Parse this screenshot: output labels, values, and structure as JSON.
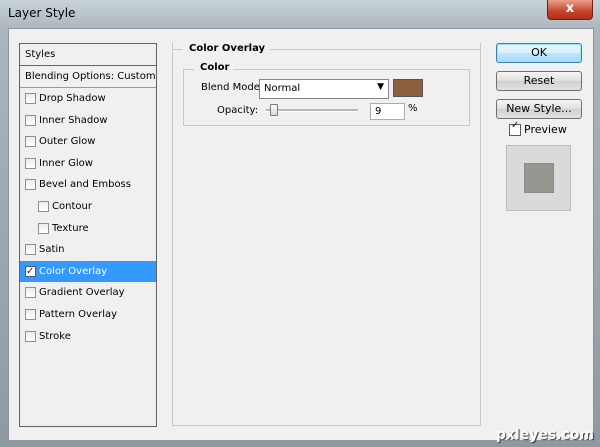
{
  "window": {
    "title": "Layer Style",
    "close_glyph": "x"
  },
  "styles": {
    "header": "Styles",
    "blending": "Blending Options: Custom",
    "items": [
      {
        "label": "Drop Shadow",
        "checked": false,
        "sub": false,
        "selected": false
      },
      {
        "label": "Inner Shadow",
        "checked": false,
        "sub": false,
        "selected": false
      },
      {
        "label": "Outer Glow",
        "checked": false,
        "sub": false,
        "selected": false
      },
      {
        "label": "Inner Glow",
        "checked": false,
        "sub": false,
        "selected": false
      },
      {
        "label": "Bevel and Emboss",
        "checked": false,
        "sub": false,
        "selected": false
      },
      {
        "label": "Contour",
        "checked": false,
        "sub": true,
        "selected": false
      },
      {
        "label": "Texture",
        "checked": false,
        "sub": true,
        "selected": false
      },
      {
        "label": "Satin",
        "checked": false,
        "sub": false,
        "selected": false
      },
      {
        "label": "Color Overlay",
        "checked": true,
        "sub": false,
        "selected": true
      },
      {
        "label": "Gradient Overlay",
        "checked": false,
        "sub": false,
        "selected": false
      },
      {
        "label": "Pattern Overlay",
        "checked": false,
        "sub": false,
        "selected": false
      },
      {
        "label": "Stroke",
        "checked": false,
        "sub": false,
        "selected": false
      }
    ]
  },
  "panel": {
    "title": "Color Overlay",
    "group_title": "Color",
    "blend_mode_label": "Blend Mode:",
    "blend_mode_value": "Normal",
    "opacity_label": "Opacity:",
    "opacity_value": "9",
    "opacity_unit": "%",
    "opacity_level": 0.09,
    "overlay_color": "#8b5e3c"
  },
  "buttons": {
    "ok": "OK",
    "reset": "Reset",
    "new_style": "New Style..."
  },
  "preview": {
    "label": "Preview",
    "checked": true
  },
  "watermark": "pxleyes.com"
}
